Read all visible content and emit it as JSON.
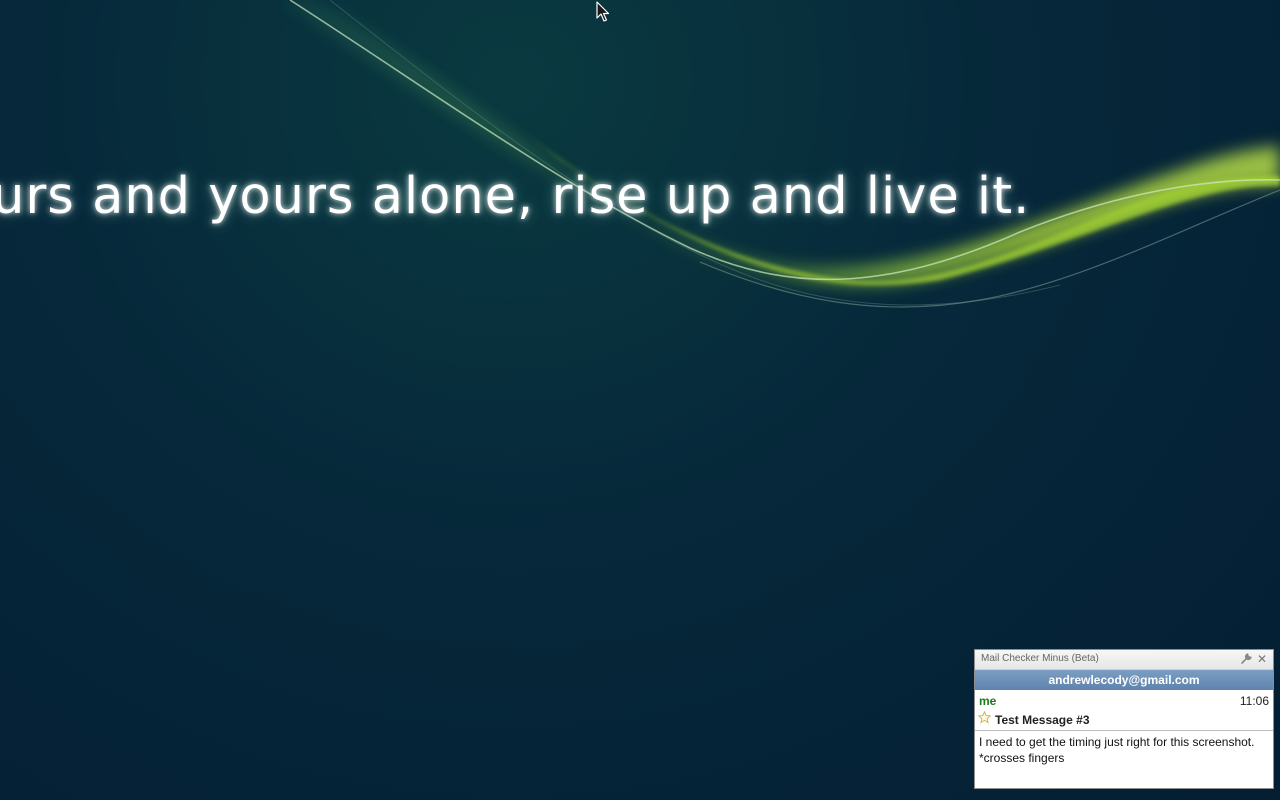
{
  "wallpaper": {
    "quote": "urs and yours alone, rise up and live it."
  },
  "notification": {
    "title": "Mail Checker Minus (Beta)",
    "account": "andrewlecody@gmail.com",
    "message": {
      "sender": "me",
      "time": "11:06",
      "subject": "Test Message #3",
      "snippet": "I need to get the timing just right for this screenshot. *crosses fingers",
      "starred": false
    },
    "close_glyph": "✕",
    "icons": [
      "wrench-icon",
      "close-icon",
      "star-icon"
    ]
  },
  "colors": {
    "sender": "#1d7a1d",
    "account_bar": "#5d83ad",
    "wave_green": "#9ccc2a"
  }
}
